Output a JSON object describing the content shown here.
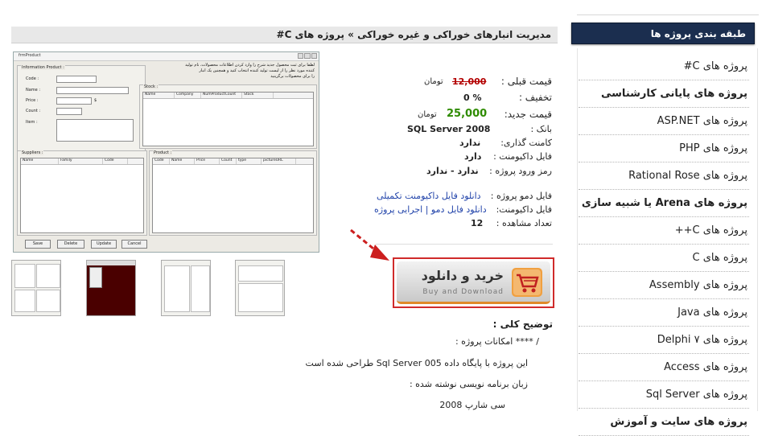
{
  "sidebar": {
    "header": "طبقه بندی پروژه ها",
    "items": [
      {
        "label": "پروژه های C#",
        "bold": false
      },
      {
        "label": "پروژه های پایانی کارشناسی",
        "bold": true
      },
      {
        "label": "پروژه های ASP.NET",
        "bold": false
      },
      {
        "label": "پروژه های PHP",
        "bold": false
      },
      {
        "label": "پروژه های Rational Rose",
        "bold": false
      },
      {
        "label": "پروژه های Arena یا شبیه سازی",
        "bold": true
      },
      {
        "label": "پروژه های C++",
        "bold": false
      },
      {
        "label": "پروژه های C",
        "bold": false
      },
      {
        "label": "پروژه های Assembly",
        "bold": false
      },
      {
        "label": "پروژه های Java",
        "bold": false
      },
      {
        "label": "پروژه های Delphi ۷",
        "bold": false
      },
      {
        "label": "پروژه های Access",
        "bold": false
      },
      {
        "label": "پروژه های Sql Server",
        "bold": false
      },
      {
        "label": "پروژه های سایت و آموزش",
        "bold": true
      }
    ]
  },
  "page": {
    "title": "مدیریت انبارهای خوراکی و غیره خوراکی » پروژه های C#"
  },
  "screenshot": {
    "window_title": "frmProduct",
    "info_group": "Information Product :",
    "labels": {
      "code": "Code :",
      "name": "Name :",
      "price": "Price :",
      "count": "Count :",
      "item": "Item :",
      "currency": "$"
    },
    "note_lines": [
      "لطفا برای ثبت محصول جدید شرح را وارد کردن اطلاعات محصولات، نام تولید",
      "کننده مورد نظر را از لیست تولید کننده انتخاب کنید و همچنین یک انبار",
      "را برای محصولات برگزینید"
    ],
    "stock_group": "Stock :",
    "stock_cols": [
      "Name",
      "Company",
      "NumProductCount",
      "Stock"
    ],
    "suppliers_group": "Suppliers :",
    "suppliers_cols": [
      "Name",
      "Family",
      "Code"
    ],
    "product_group": "Product :",
    "product_cols": [
      "Code",
      "Name",
      "Price",
      "Count",
      "type",
      "pictureURL"
    ],
    "buttons": [
      "Save",
      "Delete",
      "Update",
      "Cancel"
    ]
  },
  "info": {
    "old_price_label": "قیمت قبلی :",
    "old_price": "12,000",
    "currency": "تومان",
    "discount_label": "تخفیف :",
    "discount": "0 %",
    "new_price_label": "قیمت جدید:",
    "new_price": "25,000",
    "bank_label": "بانک :",
    "bank": "SQL Server 2008",
    "comment_label": "کامنت گذاری:",
    "comment": "ندارد",
    "doc_label": "فایل داکیومنت :",
    "doc": "دارد",
    "password_label": "رمز ورود پروژه :",
    "password": "ندارد - ندارد",
    "demo_label": "فایل دمو پروژه :",
    "demo_link": "دانلود فایل داکیومنت تکمیلی",
    "doc_file_label": "فایل داکیومنت:",
    "doc_file_link": "دانلود فایل دمو | اجرایی پروژه",
    "views_label": "تعداد مشاهده :",
    "views": "12"
  },
  "buy": {
    "label_fa": "خرید و دانلود",
    "label_en": "Buy and Download"
  },
  "description": {
    "heading": "توضیح کلی :",
    "lines": [
      "/ **** امکانات پروژه :",
      "این پروژه با پایگاه داده Sql Server 005 طراحی شده است",
      "زبان برنامه نویسی نوشته شده :",
      "سی شارپ 2008"
    ]
  },
  "colors": {
    "sidebar_header_bg": "#1b2e4f",
    "new_price": "#2e8b00",
    "old_price": "#b30000",
    "link": "#2244aa",
    "buy_border": "#d02b2b"
  }
}
